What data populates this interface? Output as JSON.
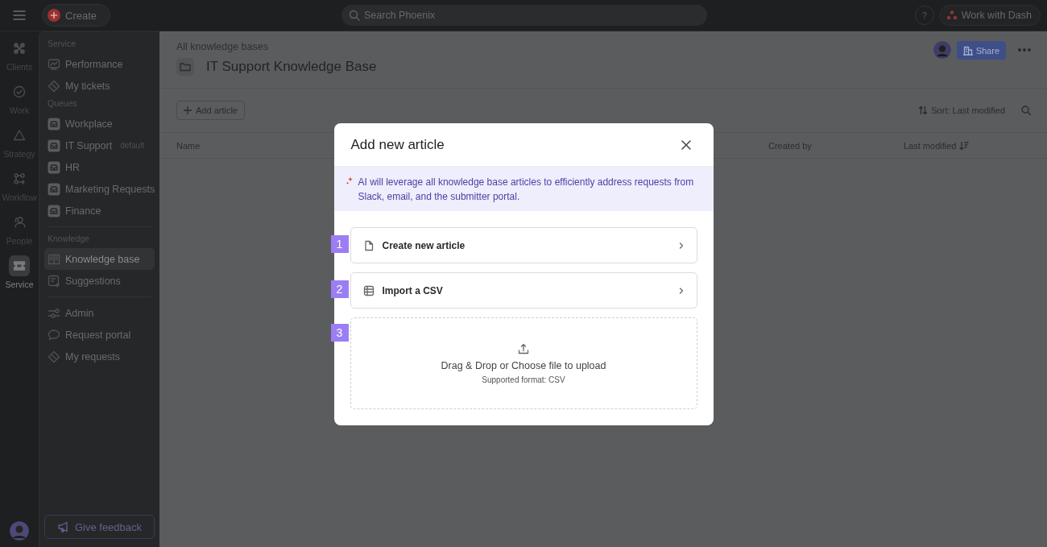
{
  "topbar": {
    "create": "Create",
    "search": {
      "placeholder": "Search Phoenix"
    },
    "help": "?",
    "assistant": "Work with Dash"
  },
  "rail": {
    "items": [
      {
        "label": "Clients",
        "kind": "clients",
        "selected": false
      },
      {
        "label": "Work",
        "kind": "work",
        "selected": false
      },
      {
        "label": "Strategy",
        "kind": "strategy",
        "selected": false
      },
      {
        "label": "Workflow",
        "kind": "workflow",
        "selected": false
      },
      {
        "label": "People",
        "kind": "people",
        "selected": false
      },
      {
        "label": "Service",
        "kind": "service",
        "selected": true
      }
    ]
  },
  "sidebar": {
    "sections": [
      {
        "heading": "Service",
        "items": [
          {
            "label": "Performance",
            "kind": "chart",
            "selected": false
          },
          {
            "label": "My tickets",
            "kind": "ticket",
            "selected": false
          }
        ]
      },
      {
        "heading": "Queues",
        "items": [
          {
            "label": "Workplace",
            "kind": "queue",
            "selected": false
          },
          {
            "label": "IT Support",
            "kind": "queue",
            "selected": false,
            "badge": "default"
          },
          {
            "label": "HR",
            "kind": "queue",
            "selected": false
          },
          {
            "label": "Marketing Requests",
            "kind": "queue",
            "selected": false
          },
          {
            "label": "Finance",
            "kind": "queue",
            "selected": false
          }
        ]
      },
      {
        "heading": "Knowledge",
        "items": [
          {
            "label": "Knowledge base",
            "kind": "book",
            "selected": true
          },
          {
            "label": "Suggestions",
            "kind": "list",
            "selected": false
          }
        ]
      },
      {
        "items": [
          {
            "label": "Admin",
            "kind": "sliders",
            "selected": false
          },
          {
            "label": "Request portal",
            "kind": "bubble",
            "selected": false
          },
          {
            "label": "My requests",
            "kind": "ticket",
            "selected": false
          }
        ]
      }
    ],
    "feedback": "Give feedback"
  },
  "main": {
    "breadcrumb": "All knowledge bases",
    "title": "IT Support Knowledge Base",
    "share": "Share",
    "add": "Add article",
    "sort": "Sort: Last modified",
    "columns": [
      {
        "label": "Name",
        "sorted": false
      },
      {
        "label": "Created by",
        "sorted": false
      },
      {
        "label": "Last modified",
        "sorted": true
      }
    ]
  },
  "modal": {
    "title": "Add new article",
    "notice": "AI will leverage all knowledge base articles to efficiently address requests from Slack, email, and the submitter portal.",
    "options": [
      {
        "marker": "1",
        "kind": "document",
        "label": "Create new article"
      },
      {
        "marker": "2",
        "kind": "table",
        "label": "Import a CSV"
      },
      {
        "marker": "3",
        "kind": "dropzone",
        "label": "Drag & Drop or Choose file to upload",
        "hint": "Supported format: CSV"
      }
    ]
  }
}
